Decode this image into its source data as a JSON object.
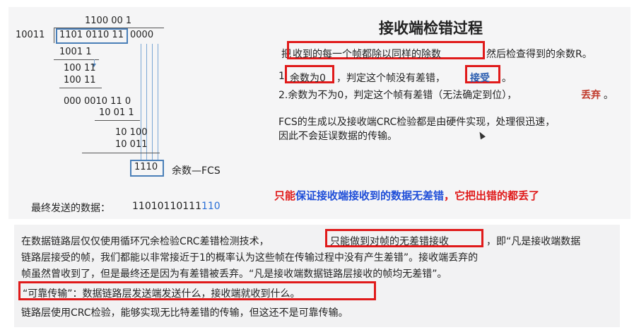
{
  "division": {
    "quotient": "1100 00 1",
    "divisor": "10011",
    "dividend_data": "1101 0110 11",
    "dividend_pad": "0000",
    "steps": [
      "1001 1",
      "100 11",
      "100 11",
      "000 0010 11  0",
      "10 01 1",
      "10 100",
      "10 011"
    ],
    "remainder": "1110",
    "remainder_label": "余数—FCS",
    "final_label": "最终发送的数据：",
    "final_data": "11010110111",
    "final_fcs": "110"
  },
  "right_panel": {
    "title": "接收端检错过程",
    "line1_prefix": "把",
    "line1_boxed": "收到的每一个帧都除以同样的除数",
    "line1_suffix": " 然后检查得到的余数R。",
    "item1_prefix": "1.",
    "item1_boxed": "余数为0",
    "item1_middle": "，判定这个帧没有差错，",
    "item1_accept": "接受",
    "item1_suffix": "。",
    "item2_text": "2.余数为不为0，判定这个帧有差错（无法确定到位），",
    "item2_discard": "丢弃",
    "item2_suffix": "。",
    "fcs_note_line1": "FCS的生成以及接收端CRC检验都是由硬件实现，处理很迅速，",
    "fcs_note_line2": "因此不会延误数据的传输。"
  },
  "annotation": {
    "part1": "只能",
    "part2": "保证接收端接收到的数据无差错",
    "part3": "，它把出错的都丢了"
  },
  "bottom": {
    "p1_line1_a": "在数据链路层仅仅使用循环冗余检验CRC差错检测技术，",
    "p1_line1_boxed": "只能做到对帧的无差错接收",
    "p1_line1_b": "，即“凡是接收端数据",
    "p1_line2": "链路层接受的帧，我们都能以非常接近于1的概率认为这些帧在传输过程中没有产生差错”。接收端丢弃的",
    "p1_line3": "帧虽然曾收到了，但是最终还是因为有差错被丢弃。“凡是接收端数据链路层接收的帧均无差错”。",
    "p2_boxed": "“可靠传输”：数据链路层发送端发送什么，接收端就收到什么。",
    "p3": "链路层使用CRC检验，能够实现无比特差错的传输，但这还不是可靠传输。"
  },
  "colors": {
    "red": "#e01a1a",
    "blue_box": "#4a7fb8",
    "accept_blue": "#2a5db0",
    "discard_red": "#c0392b",
    "annotation_blue": "#1f4ed8",
    "fcs_blue": "#2a6fd6"
  }
}
